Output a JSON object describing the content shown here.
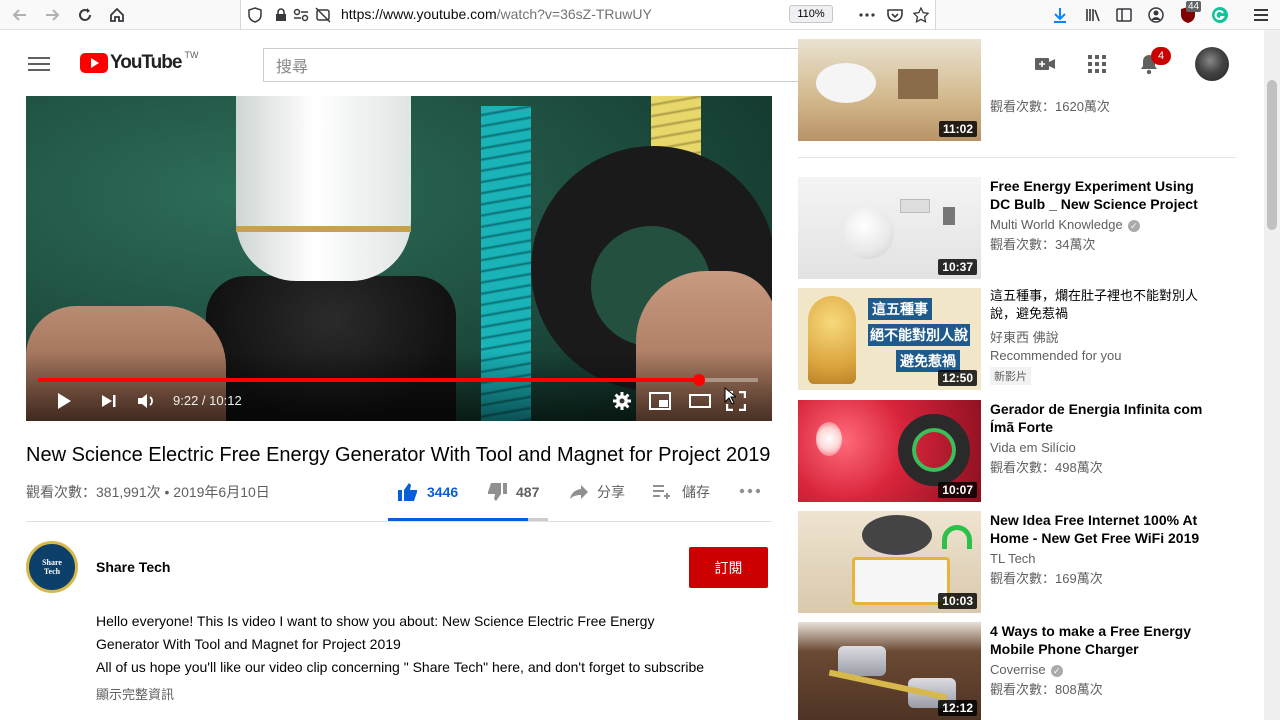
{
  "browser": {
    "url_host": "https://www.youtube.com",
    "url_rest": "/watch?v=36sZ-TRuwUY",
    "zoom": "110%",
    "ext_badge": "44"
  },
  "header": {
    "logo_text": "YouTube",
    "logo_region": "TW",
    "search_placeholder": "搜尋",
    "notification_count": "4"
  },
  "player": {
    "time_current": "9:22",
    "time_total": "10:12",
    "time_display": "9:22 / 10:12",
    "progress_fraction": 0.918
  },
  "video": {
    "title": "New Science Electric Free Energy Generator With Tool and Magnet for Project 2019",
    "views_date": "觀看次數：381,991次 • 2019年6月10日",
    "likes": "3446",
    "dislikes": "487",
    "share_label": "分享",
    "save_label": "儲存",
    "like_fraction": 0.876
  },
  "channel": {
    "name": "Share Tech",
    "avatar_line1": "Share",
    "avatar_line2": "Tech",
    "subscribe_label": "訂閱"
  },
  "description": {
    "line1": "Hello everyone! This Is video I want to show you about: New Science Electric  Free Energy",
    "line2": "Generator With Tool and Magnet for Project 2019",
    "line3": "All of us hope you'll like our video clip concerning \" Share Tech\" here, and don't forget to subscribe",
    "show_more": "顯示完整資訊"
  },
  "sidebar": {
    "items": [
      {
        "title": "",
        "channel": "",
        "views": "觀看次數：1620萬次",
        "duration": "11:02"
      },
      {
        "title": "Free Energy Experiment Using DC Bulb _ New Science Project",
        "channel": "Multi World Knowledge",
        "views": "觀看次數：34萬次",
        "duration": "10:37"
      },
      {
        "title": "這五種事，爛在肚子裡也不能對別人說，避免惹禍",
        "channel": "好東西 佛說",
        "views": "Recommended for you",
        "badge": "新影片",
        "duration": "12:50",
        "thumb_text1": "這五種事",
        "thumb_text2": "絕不能對別人說",
        "thumb_text3": "避免惹禍"
      },
      {
        "title": "Gerador de Energia Infinita com Ímã Forte",
        "channel": "Vida em Silício",
        "views": "觀看次數：498萬次",
        "duration": "10:07"
      },
      {
        "title": "New Idea Free Internet 100% At Home - New Get Free WiFi 2019",
        "channel": "TL Tech",
        "views": "觀看次數：169萬次",
        "duration": "10:03"
      },
      {
        "title": "4 Ways to make a Free Energy Mobile Phone Charger",
        "channel": "Coverrise",
        "views": "觀看次數：808萬次",
        "duration": "12:12"
      }
    ]
  }
}
